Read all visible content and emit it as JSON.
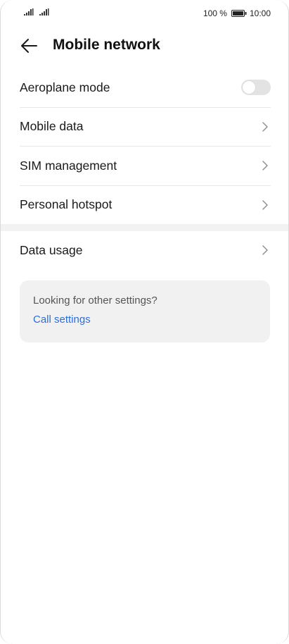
{
  "status_bar": {
    "battery_percent": "100 %",
    "time": "10:00"
  },
  "header": {
    "title": "Mobile network",
    "back_icon": "arrow-left-icon"
  },
  "list": {
    "items": [
      {
        "label": "Aeroplane mode",
        "control": "toggle",
        "toggle_on": false
      },
      {
        "label": "Mobile data",
        "control": "chevron"
      },
      {
        "label": "SIM management",
        "control": "chevron"
      },
      {
        "label": "Personal hotspot",
        "control": "chevron"
      },
      {
        "label": "Data usage",
        "control": "chevron"
      }
    ]
  },
  "card": {
    "text": "Looking for other settings?",
    "link": "Call settings"
  },
  "colors": {
    "accent": "#2a6fdb",
    "toggle_off": "#e3e3e3",
    "card_bg": "#f1f1f1"
  }
}
